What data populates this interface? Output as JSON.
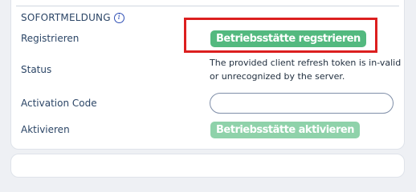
{
  "section": {
    "title": "SOFORTMELDUNG",
    "info_icon": "info-icon"
  },
  "rows": {
    "register": {
      "label": "Registrieren",
      "button_label": "Betriebsstätte regstrieren"
    },
    "status": {
      "label": "Status",
      "text": "The provided client refresh token is in-valid or unrecognized by the server."
    },
    "activation_code": {
      "label": "Activation Code",
      "value": ""
    },
    "activate": {
      "label": "Aktivieren",
      "button_label": "Betriebsstätte aktivieren"
    }
  },
  "colors": {
    "button_green": "#53b97f",
    "button_disabled_green": "#8fd2aa",
    "highlight_red": "#dc1f1f",
    "text": "#2b4566"
  }
}
